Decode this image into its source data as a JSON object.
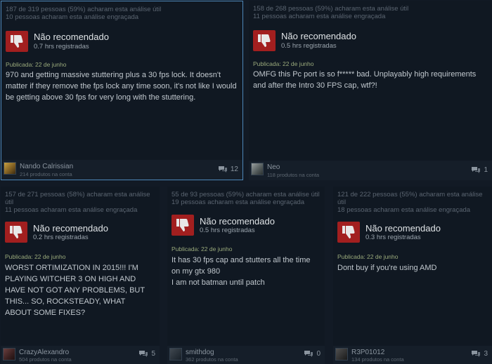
{
  "reviews": [
    {
      "helpful": "187 de 319 pessoas (59%) acharam esta análise útil",
      "funny": "10 pessoas acharam esta análise engraçada",
      "verdict": "Não recomendado",
      "hours": "0.7 hrs registradas",
      "posted": "Publicada: 22 de junho",
      "text": "970 and getting massive stuttering plus a 30 fps lock. It doesn't matter if they remove the fps lock any time soon, it's not like I would be getting above 30 fps for very long with the stuttering.",
      "author": "Nando Calrissian",
      "products": "214 produtos na conta",
      "comments": "12"
    },
    {
      "helpful": "158 de 268 pessoas (59%) acharam esta análise útil",
      "funny": "11 pessoas acharam esta análise engraçada",
      "verdict": "Não recomendado",
      "hours": "0.5 hrs registradas",
      "posted": "Publicada: 22 de junho",
      "text": "OMFG this Pc port is so f***** bad. Unplayably high requirements and after the Intro 30 FPS cap, wtf?!",
      "author": "Neo",
      "products": "118 produtos na conta",
      "comments": "1"
    },
    {
      "helpful": "157 de 271 pessoas (58%) acharam esta análise útil",
      "funny": "11 pessoas acharam esta análise engraçada",
      "verdict": "Não recomendado",
      "hours": "0.2 hrs registradas",
      "posted": "Publicada: 22 de junho",
      "text": "WORST ORTIMIZATION IN 2015!!! I'M PLAYING WITCHER 3 ON HIGH AND HAVE NOT GOT ANY PROBLEMS, BUT THIS... SO, ROCKSTEADY, WHAT ABOUT SOME FIXES?",
      "author": "CrazyAlexandro",
      "products": "504 produtos na conta",
      "comments": "5"
    },
    {
      "helpful": "55 de 93 pessoas (59%) acharam esta análise útil",
      "funny": "19 pessoas acharam esta análise engraçada",
      "verdict": "Não recomendado",
      "hours": "0.5 hrs registradas",
      "posted": "Publicada: 22 de junho",
      "text": "It has 30 fps cap and stutters all the time on my gtx 980",
      "text2": "I am not batman until patch",
      "author": "smithdog",
      "products": "362 produtos na conta",
      "comments": "0"
    },
    {
      "helpful": "121 de 222 pessoas (55%) acharam esta análise útil",
      "funny": "18 pessoas acharam esta análise engraçada",
      "verdict": "Não recomendado",
      "hours": "0.3 hrs registradas",
      "posted": "Publicada: 22 de junho",
      "text": "Dont buy if you're using AMD",
      "author": "R3P01012",
      "products": "134 produtos na conta",
      "comments": "3"
    }
  ],
  "colors": {
    "background": "#121a25",
    "card": "#101822",
    "thumb_down": "#a21f1f",
    "posted_date": "#9aaa7c",
    "highlight_border": "#4d87b8"
  },
  "icons": {
    "verdict": "thumbs-down-icon",
    "comments": "speech-bubble-icon"
  }
}
